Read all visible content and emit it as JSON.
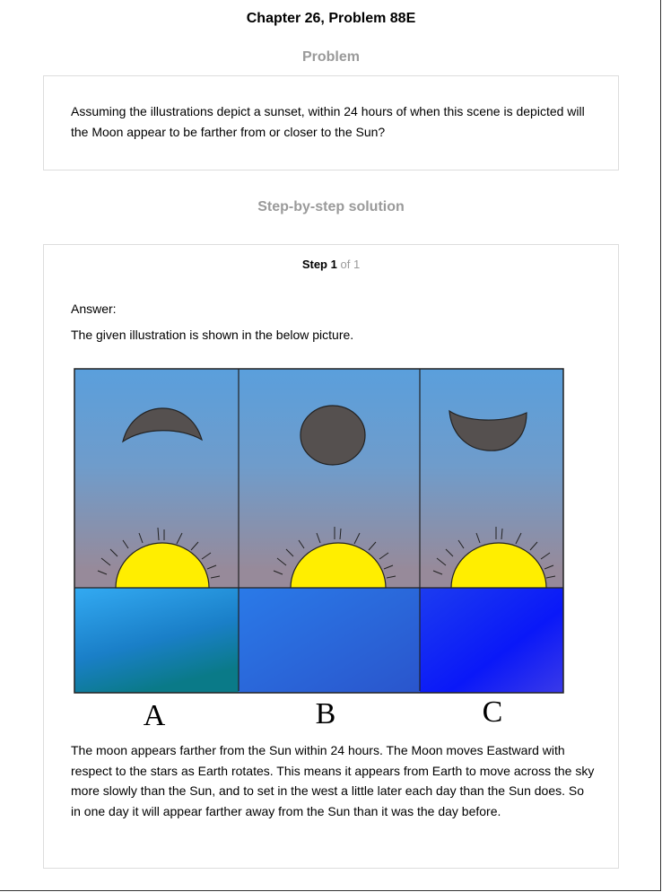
{
  "header": {
    "title": "Chapter 26, Problem 88E"
  },
  "problem": {
    "heading": "Problem",
    "text": "Assuming the illustrations depict a sunset, within 24 hours of when this scene is depicted will the Moon appear to be farther from or closer to the Sun?"
  },
  "solution": {
    "heading": "Step-by-step solution",
    "step_label": "Step",
    "step_number": "1",
    "step_of": "of 1",
    "answer_label": "Answer:",
    "intro": "The given illustration is shown in the below picture.",
    "panels": [
      "A",
      "B",
      "C"
    ],
    "explanation": "The moon appears farther from the Sun within 24 hours. The Moon moves Eastward with respect to the stars as Earth rotates. This means it appears from Earth to move across the sky more slowly than the Sun, and to set in the west a little later each day than the Sun does. So in one day it will appear farther away from the Sun than it was the day before."
  },
  "colors": {
    "sky_top": "#5a9fdc",
    "sky_bottom": "#978a9a",
    "sun": "#ffee00",
    "moon": "#55504f",
    "water_a": "#2aa0e6",
    "water_b": "#2a68dc",
    "water_c": "#1028f0"
  }
}
